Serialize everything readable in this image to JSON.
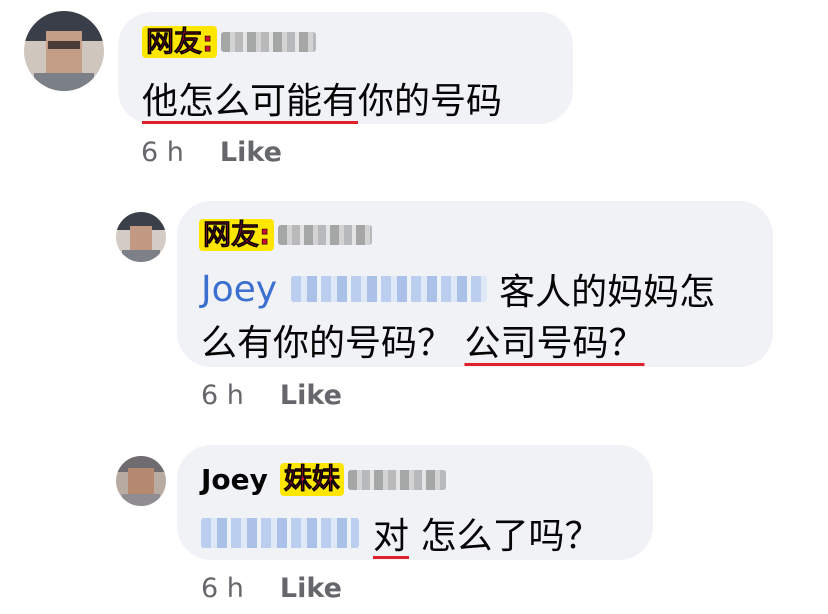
{
  "comments": [
    {
      "tag": "网友:",
      "text_underlined": "他怎么可能有",
      "text_rest": "你的号码",
      "time": "6 h",
      "like": "Like"
    },
    {
      "tag": "网友:",
      "mention": "Joey",
      "line1_rest": "客人的妈妈怎",
      "line2_plain": "么有你的号码？ ",
      "line2_underlined": "公司号码？",
      "time": "6 h",
      "like": "Like"
    },
    {
      "name": "Joey",
      "tag": "妹妹",
      "underlined": "对",
      "rest": " 怎么了吗？",
      "time": "6 h",
      "like": "Like"
    }
  ]
}
